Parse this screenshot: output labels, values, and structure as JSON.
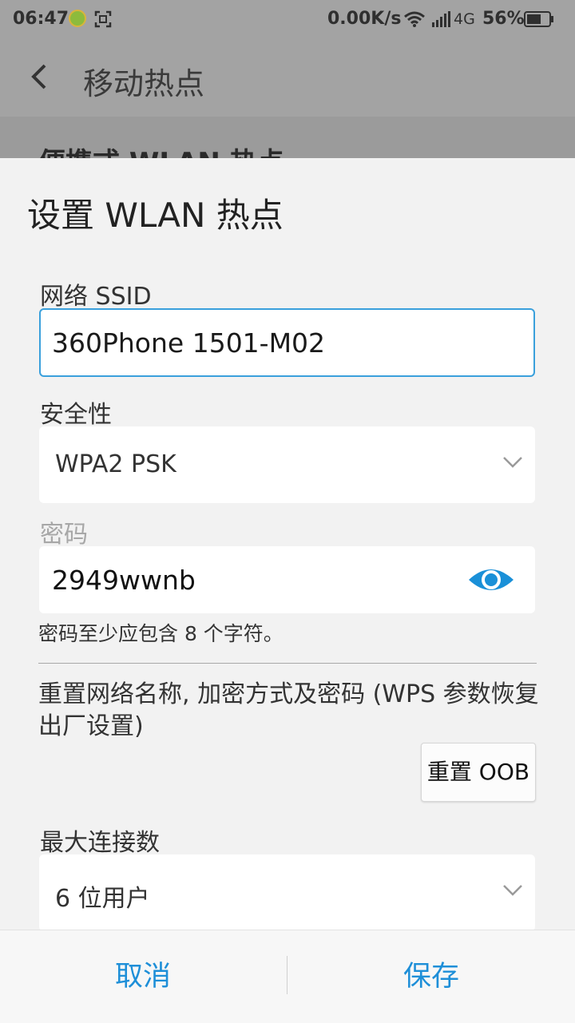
{
  "status_bar": {
    "time": "06:47",
    "net_speed": "0.00K/s",
    "network_type": "4G",
    "battery_percent": "56%",
    "icons": [
      "app-badge-icon",
      "screen-scan-icon",
      "wifi-icon",
      "signal-icon",
      "battery-icon"
    ]
  },
  "app_bar": {
    "title": "移动热点",
    "behind_text": "便携式 WLAN 热点"
  },
  "dialog": {
    "title": "设置 WLAN 热点",
    "ssid_label": "网络 SSID",
    "ssid_value": "360Phone 1501-M02",
    "security_label": "安全性",
    "security_value": "WPA2 PSK",
    "password_label": "密码",
    "password_value": "2949wwnb",
    "password_hint": "密码至少应包含 8 个字符。",
    "reset_description": "重置网络名称, 加密方式及密码 (WPS 参数恢复出厂设置)",
    "reset_button": "重置 OOB",
    "max_connections_label": "最大连接数",
    "max_connections_value": "6 位用户",
    "cancel_button": "取消",
    "save_button": "保存"
  },
  "colors": {
    "accent": "#1e8fd8",
    "focus_border": "#3aa0dc",
    "eye_icon": "#1a90d8"
  }
}
